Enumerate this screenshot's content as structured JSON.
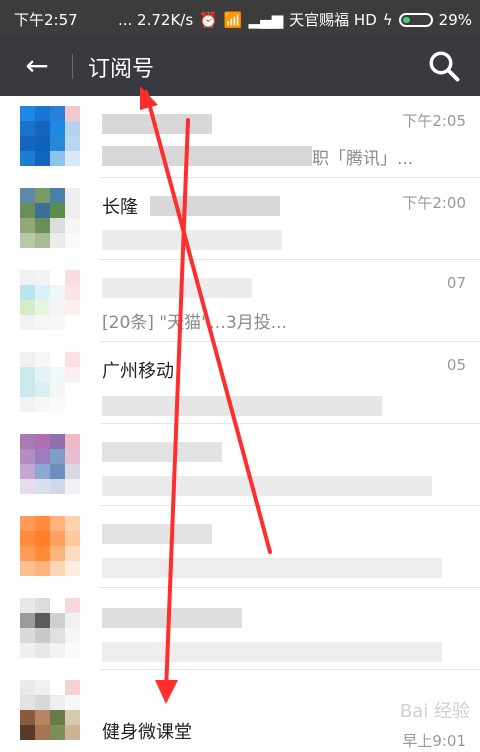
{
  "status_bar": {
    "time": "下午2:57",
    "network_speed": "... 2.72K/s",
    "carrier": "天官赐福 HD",
    "battery": "29%"
  },
  "app_bar": {
    "title": "订阅号"
  },
  "list": {
    "items": [
      {
        "name": "",
        "time": "下午2:05",
        "snippet": "职「腾讯」..."
      },
      {
        "name": "长隆",
        "time": "下午2:00",
        "snippet": ""
      },
      {
        "name": "",
        "time": "07",
        "snippet": "[20条] \"天猫\"…3月投..."
      },
      {
        "name": "广州移动",
        "time": "05",
        "snippet": ""
      },
      {
        "name": "",
        "time": "",
        "snippet": ""
      },
      {
        "name": "",
        "time": "",
        "snippet": ""
      },
      {
        "name": "",
        "time": "",
        "snippet": ""
      },
      {
        "name": "健身微课堂",
        "time": "早上9:01",
        "snippet": ""
      }
    ]
  },
  "watermark": "Bai 经验"
}
